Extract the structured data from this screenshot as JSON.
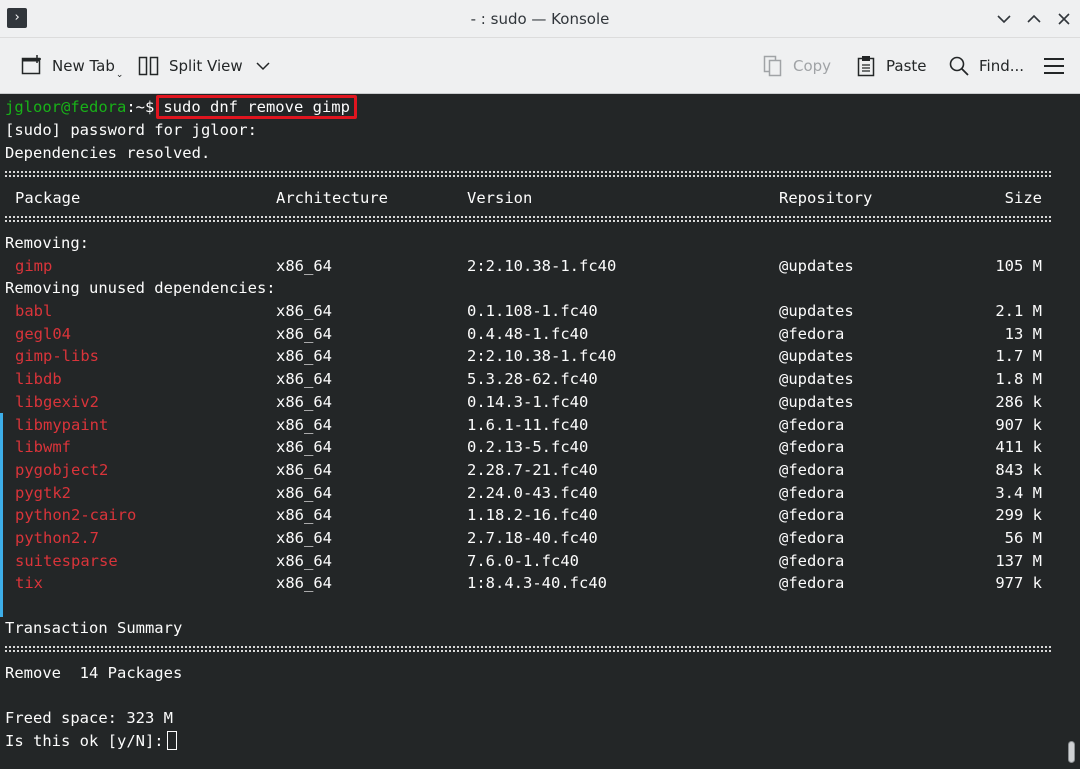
{
  "window": {
    "title": "- : sudo — Konsole",
    "app_icon": "terminal-icon",
    "controls": [
      "minimize-icon",
      "maximize-icon",
      "close-icon"
    ]
  },
  "toolbar": {
    "new_tab": "New Tab",
    "split_view": "Split View",
    "copy": "Copy",
    "paste": "Paste",
    "find": "Find...",
    "menu_icon": "hamburger-menu-icon"
  },
  "terminal": {
    "prompt_user": "jgloor@fedora",
    "prompt_path": ":~$",
    "command": "sudo dnf remove gimp",
    "password_prompt": "[sudo] password for jgloor:",
    "deps_resolved": "Dependencies resolved.",
    "headers": {
      "package": "Package",
      "arch": "Architecture",
      "version": "Version",
      "repo": "Repository",
      "size": "Size"
    },
    "removing_label": "Removing:",
    "removing": [
      {
        "name": "gimp",
        "arch": "x86_64",
        "version": "2:2.10.38-1.fc40",
        "repo": "@updates",
        "size": "105 M"
      }
    ],
    "unused_label": "Removing unused dependencies:",
    "unused": [
      {
        "name": "babl",
        "arch": "x86_64",
        "version": "0.1.108-1.fc40",
        "repo": "@updates",
        "size": "2.1 M"
      },
      {
        "name": "gegl04",
        "arch": "x86_64",
        "version": "0.4.48-1.fc40",
        "repo": "@fedora",
        "size": "13 M"
      },
      {
        "name": "gimp-libs",
        "arch": "x86_64",
        "version": "2:2.10.38-1.fc40",
        "repo": "@updates",
        "size": "1.7 M"
      },
      {
        "name": "libdb",
        "arch": "x86_64",
        "version": "5.3.28-62.fc40",
        "repo": "@updates",
        "size": "1.8 M"
      },
      {
        "name": "libgexiv2",
        "arch": "x86_64",
        "version": "0.14.3-1.fc40",
        "repo": "@updates",
        "size": "286 k"
      },
      {
        "name": "libmypaint",
        "arch": "x86_64",
        "version": "1.6.1-11.fc40",
        "repo": "@fedora",
        "size": "907 k"
      },
      {
        "name": "libwmf",
        "arch": "x86_64",
        "version": "0.2.13-5.fc40",
        "repo": "@fedora",
        "size": "411 k"
      },
      {
        "name": "pygobject2",
        "arch": "x86_64",
        "version": "2.28.7-21.fc40",
        "repo": "@fedora",
        "size": "843 k"
      },
      {
        "name": "pygtk2",
        "arch": "x86_64",
        "version": "2.24.0-43.fc40",
        "repo": "@fedora",
        "size": "3.4 M"
      },
      {
        "name": "python2-cairo",
        "arch": "x86_64",
        "version": "1.18.2-16.fc40",
        "repo": "@fedora",
        "size": "299 k"
      },
      {
        "name": "python2.7",
        "arch": "x86_64",
        "version": "2.7.18-40.fc40",
        "repo": "@fedora",
        "size": "56 M"
      },
      {
        "name": "suitesparse",
        "arch": "x86_64",
        "version": "7.6.0-1.fc40",
        "repo": "@fedora",
        "size": "137 M"
      },
      {
        "name": "tix",
        "arch": "x86_64",
        "version": "1:8.4.3-40.fc40",
        "repo": "@fedora",
        "size": "977 k"
      }
    ],
    "summary_label": "Transaction Summary",
    "remove_count": "Remove  14 Packages",
    "freed_space": "Freed space: 323 M",
    "confirm_prompt": "Is this ok [y/N]:"
  }
}
